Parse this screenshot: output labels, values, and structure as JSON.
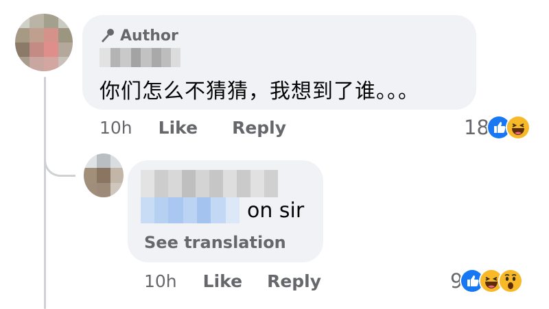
{
  "comment": {
    "author_badge": "Author",
    "text": "你们怎么不猜猜，我想到了谁。。。",
    "time": "10h",
    "like_label": "Like",
    "reply_label": "Reply",
    "reaction_count": "18",
    "reactions": [
      "like-reaction-icon",
      "haha-reaction-icon"
    ]
  },
  "reply": {
    "text": "on sir",
    "see_translation": "See translation",
    "time": "10h",
    "like_label": "Like",
    "reply_label": "Reply",
    "reaction_count": "9",
    "reactions": [
      "like-reaction-icon",
      "haha-reaction-icon",
      "wow-reaction-icon"
    ]
  },
  "colors": {
    "bubble": "#f0f2f5",
    "secondary_text": "#65676b",
    "like_blue": "#1877f2",
    "emoji_yellow": "#f7b928",
    "thread_line": "#ced0d4"
  }
}
